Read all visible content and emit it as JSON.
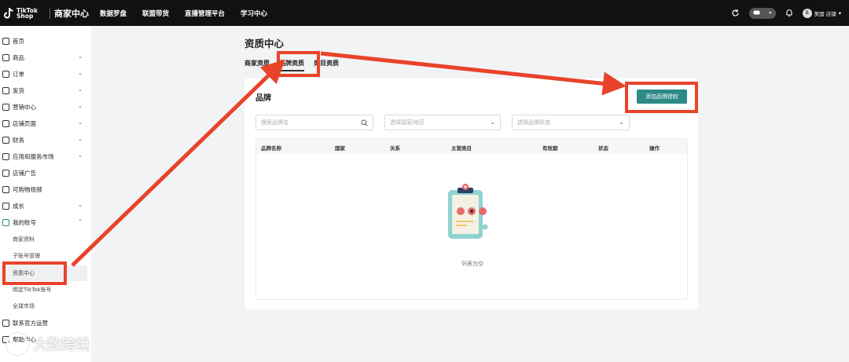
{
  "topbar": {
    "logo_line1": "TikTok",
    "logo_line2": "Shop",
    "title": "商家中心",
    "nav": [
      "数据罗盘",
      "联盟带货",
      "直播管理平台",
      "学习中心"
    ],
    "shop_label": "美国 店铺",
    "avatar_letter": "B"
  },
  "sidebar": {
    "items": [
      {
        "label": "首页",
        "icon": "home-icon"
      },
      {
        "label": "商品",
        "icon": "product-icon"
      },
      {
        "label": "订单",
        "icon": "order-icon"
      },
      {
        "label": "发货",
        "icon": "shipping-icon"
      },
      {
        "label": "营销中心",
        "icon": "marketing-icon"
      },
      {
        "label": "店铺页面",
        "icon": "store-icon"
      },
      {
        "label": "财务",
        "icon": "finance-icon"
      },
      {
        "label": "应用和服务市场",
        "icon": "apps-icon"
      },
      {
        "label": "店铺广告",
        "icon": "ads-icon"
      },
      {
        "label": "可购物视频",
        "icon": "video-icon"
      },
      {
        "label": "成长",
        "icon": "growth-icon"
      },
      {
        "label": "我的账号",
        "icon": "account-icon"
      }
    ],
    "sub_items": [
      "商家资料",
      "子账号管理",
      "资质中心",
      "绑定TikTok账号",
      "全球市场"
    ],
    "bottom_items": [
      "联系官方运营",
      "帮助中心"
    ]
  },
  "main": {
    "page_title": "资质中心",
    "tabs": [
      "商家资质",
      "品牌资质",
      "类目资质"
    ],
    "card_title": "品牌",
    "add_button": "添加品牌授权",
    "search_placeholder": "搜索品牌名",
    "country_placeholder": "选择国家/地区",
    "status_placeholder": "选择品牌状态",
    "columns": [
      "品牌名称",
      "国家",
      "关系",
      "主营类目",
      "有效期",
      "状态",
      "操作"
    ],
    "empty_text": "列表为空"
  },
  "watermark": "大数跨境",
  "colors": {
    "accent": "#2d8a86",
    "annotation": "#e8432a",
    "topbar": "#111111"
  }
}
